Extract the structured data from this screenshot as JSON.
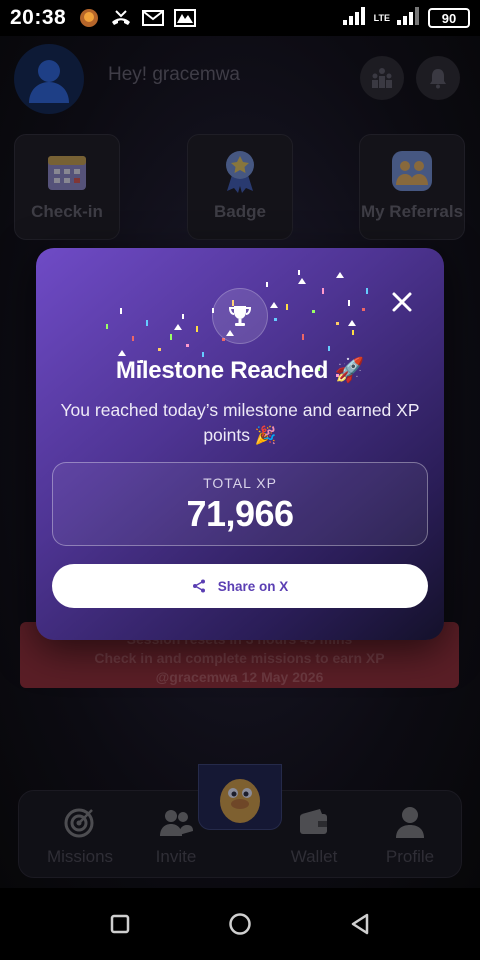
{
  "status_bar": {
    "time": "20:38",
    "battery": "90",
    "network_label": "LTE"
  },
  "header": {
    "greeting": "Hey! gracemwa"
  },
  "tiles": [
    {
      "label": "Check-in"
    },
    {
      "label": "Badge"
    },
    {
      "label": "My Referrals"
    }
  ],
  "session_banner": {
    "line1": "Session resets in 3 hours 45 mins",
    "line2": "Check in and complete missions to earn XP",
    "line3": "@gracemwa 12 May 2026"
  },
  "bottom_nav": {
    "items": [
      {
        "label": "Missions"
      },
      {
        "label": "Invite"
      },
      {
        "label": "Wallet"
      },
      {
        "label": "Profile"
      }
    ]
  },
  "modal": {
    "title": "Milestone Reached 🚀",
    "subtitle": "You reached today’s milestone and earned XP points 🎉",
    "xp_label": "TOTAL XP",
    "xp_value": "71,966",
    "share_label": "Share on X"
  },
  "colors": {
    "modal_gradient_start": "#6f4bc6",
    "modal_gradient_end": "#14112a",
    "share_text": "#5b3fb3",
    "banner": "#5a1e26"
  },
  "icons": {
    "trophy": "trophy-icon",
    "close": "close-icon",
    "share": "share-icon"
  }
}
